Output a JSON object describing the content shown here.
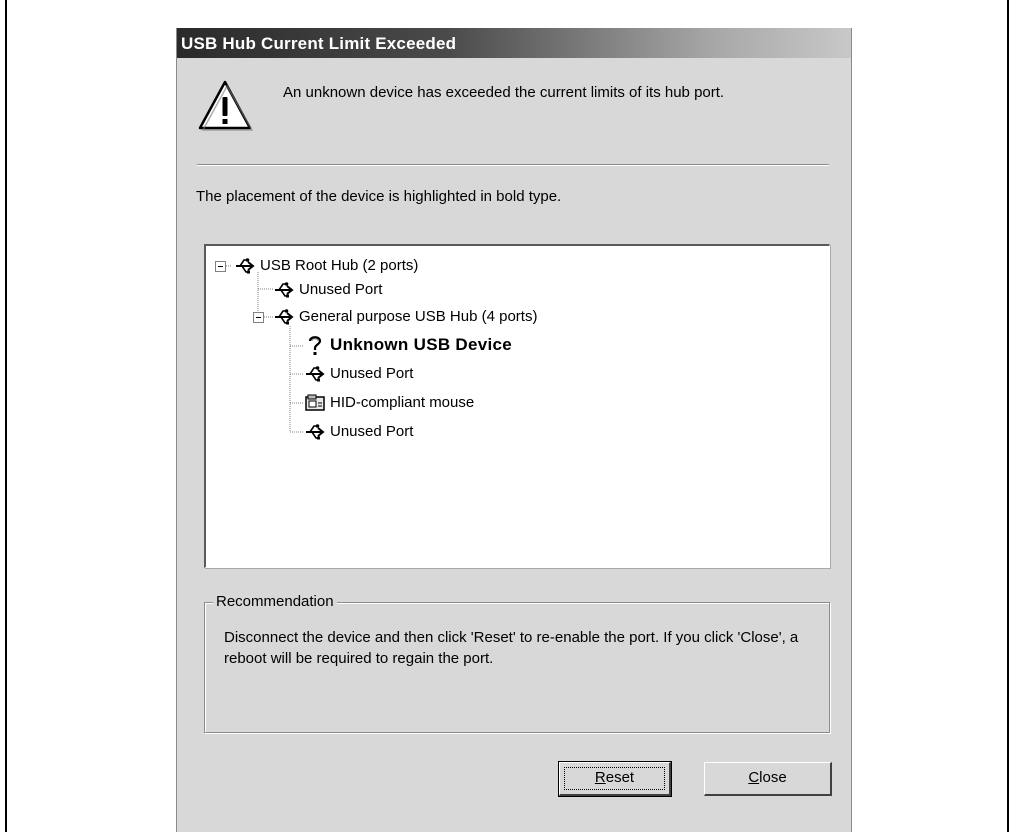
{
  "window": {
    "title": "USB Hub Current Limit Exceeded"
  },
  "message": {
    "icon": "warning-icon",
    "text": "An unknown device has exceeded the current limits of its hub port."
  },
  "instruction": "The placement of the device is highlighted in bold type.",
  "tree": {
    "nodes": [
      {
        "label": "USB Root Hub (2 ports)",
        "icon": "usb-icon",
        "bold": false,
        "expanded": true
      },
      {
        "label": "Unused Port",
        "icon": "usb-icon",
        "bold": false
      },
      {
        "label": "General purpose USB Hub (4 ports)",
        "icon": "usb-icon",
        "bold": false,
        "expanded": true
      },
      {
        "label": "Unknown USB Device",
        "icon": "question-icon",
        "bold": true
      },
      {
        "label": "Unused Port",
        "icon": "usb-icon",
        "bold": false
      },
      {
        "label": "HID-compliant mouse",
        "icon": "device-icon",
        "bold": false
      },
      {
        "label": "Unused Port",
        "icon": "usb-icon",
        "bold": false
      }
    ]
  },
  "recommendation": {
    "title": "Recommendation",
    "text": "Disconnect the device and then click 'Reset' to re-enable the port. If you click 'Close', a reboot will be required to regain the port."
  },
  "buttons": {
    "reset": {
      "accel": "R",
      "rest": "eset"
    },
    "close": {
      "accel": "C",
      "rest": "lose"
    }
  }
}
